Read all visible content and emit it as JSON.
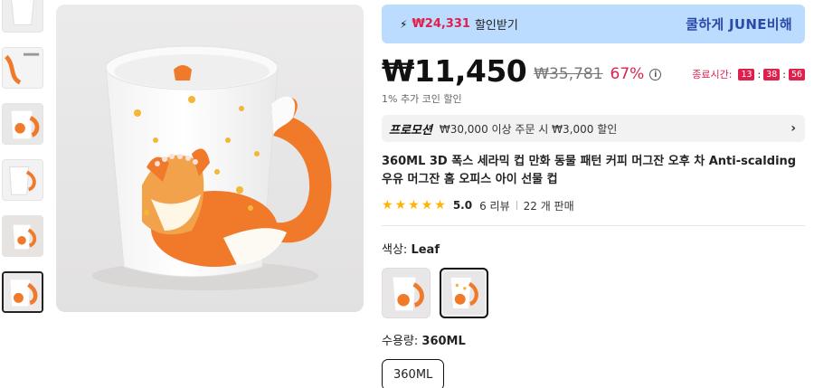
{
  "thumbnails": [
    {
      "name": "mug-front"
    },
    {
      "name": "mug-label"
    },
    {
      "name": "mug-fox-side"
    },
    {
      "name": "mug-handle"
    },
    {
      "name": "mug-room"
    },
    {
      "name": "mug-main",
      "selected": true
    }
  ],
  "banner": {
    "icon": "bolt-icon",
    "discount_amount": "₩24,331",
    "discount_text": "할인받기",
    "slogan": "쿨하게 JUNE비해",
    "background": "#bcdcff"
  },
  "price": {
    "current": "₩11,450",
    "original": "₩35,781",
    "discount_percent": "67%",
    "coin_text": "1% 추가 코인 할인"
  },
  "countdown": {
    "label": "종료시간:",
    "hours": "13",
    "minutes": "38",
    "seconds": "56"
  },
  "promotion": {
    "tag": "프로모션",
    "text": "₩30,000 이상 주문 시 ₩3,000 할인"
  },
  "product": {
    "title": "360ML 3D 폭스 세라믹 컵 만화 동물 패턴 커피 머그잔 오후 차 Anti-scalding 우유 머그잔 홈 오피스 아이 선물 컵",
    "rating": "5.0",
    "stars": 5,
    "reviews": "6 리뷰",
    "sold": "22 개 판매"
  },
  "color": {
    "label": "색상:",
    "value": "Leaf",
    "options": [
      {
        "name": "plain-fox"
      },
      {
        "name": "leaf",
        "selected": true
      }
    ]
  },
  "capacity": {
    "label": "수용량:",
    "value": "360ML",
    "options": [
      "360ML"
    ]
  },
  "accent_colors": {
    "red": "#e0204c",
    "banner_blue": "#bcdcff",
    "slogan_blue": "#2b4aa6",
    "star": "#ffb400"
  }
}
